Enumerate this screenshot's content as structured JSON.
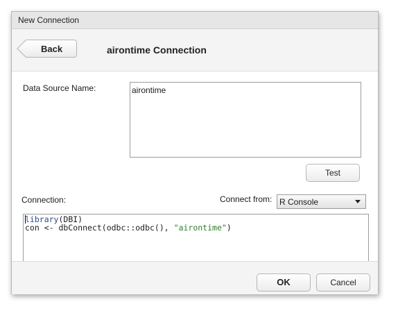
{
  "window": {
    "title": "New Connection"
  },
  "header": {
    "back_label": "Back",
    "connection_title": "airontime Connection"
  },
  "form": {
    "dsn_label": "Data Source Name:",
    "dsn_value": "airontime",
    "test_label": "Test",
    "connection_label": "Connection:",
    "connect_from_label": "Connect from:",
    "connect_from_value": "R Console"
  },
  "code": {
    "line1_fn": "library",
    "line1_rest": "(DBI)",
    "line2_pre": "con <- dbConnect(odbc::odbc(), ",
    "line2_str": "\"airontime\"",
    "line2_post": ")"
  },
  "footer": {
    "ok_label": "OK",
    "cancel_label": "Cancel"
  },
  "icons": {
    "back": "back-arrow-icon",
    "dropdown": "chevron-down-icon"
  }
}
